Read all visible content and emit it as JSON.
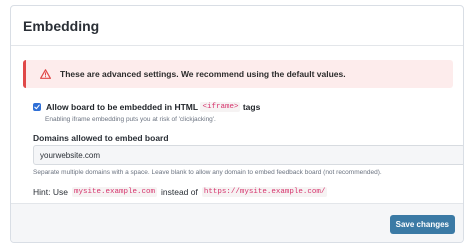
{
  "panel": {
    "title": "Embedding"
  },
  "alert": {
    "icon": "warning-triangle-icon",
    "text": "These are advanced settings. We recommend using the default values.",
    "color": "#e04848",
    "background": "#fdecec"
  },
  "embed_option": {
    "checked": true,
    "label_before": "Allow board to be embedded in HTML",
    "code": "<iframe>",
    "label_after": "tags",
    "help": "Enabling iframe embedding puts you at risk of 'clickjacking'."
  },
  "domains": {
    "label": "Domains allowed to embed board",
    "value": "yourwebsite.com",
    "help": "Separate multiple domains with a space. Leave blank to allow any domain to embed feedback board (not recommended).",
    "hint_prefix": "Hint: Use",
    "hint_code_1": "mysite.example.com",
    "hint_middle": "instead of",
    "hint_code_2": "https://mysite.example.com/"
  },
  "footer": {
    "save_label": "Save changes",
    "button_color": "#3b7aa5"
  }
}
